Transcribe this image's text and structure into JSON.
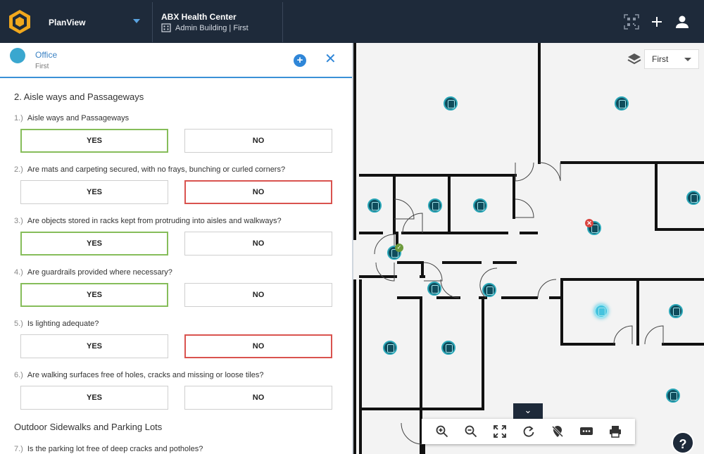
{
  "header": {
    "app_name": "PlanView",
    "site_title": "ABX Health Center",
    "site_sub": "Admin Building | First",
    "icons": [
      "qr-code-icon",
      "plus-icon",
      "user-icon"
    ]
  },
  "panel": {
    "location_title": "Office",
    "location_sub": "First",
    "section_title": "2. Aisle ways and Passageways",
    "questions": [
      {
        "num": "1.)",
        "text": "Aisle ways and Passageways",
        "yes": "YES",
        "no": "NO",
        "selected": "yes"
      },
      {
        "num": "2.)",
        "text": "Are mats and carpeting secured, with no frays, bunching or curled corners?",
        "yes": "YES",
        "no": "NO",
        "selected": "no"
      },
      {
        "num": "3.)",
        "text": "Are objects stored in racks kept from protruding into aisles and walkways?",
        "yes": "YES",
        "no": "NO",
        "selected": "yes"
      },
      {
        "num": "4.)",
        "text": "Are guardrails provided where necessary?",
        "yes": "YES",
        "no": "NO",
        "selected": "yes"
      },
      {
        "num": "5.)",
        "text": "Is lighting adequate?",
        "yes": "YES",
        "no": "NO",
        "selected": "no"
      },
      {
        "num": "6.)",
        "text": "Are walking surfaces free of holes, cracks and missing or loose tiles?",
        "yes": "YES",
        "no": "NO",
        "selected": "none"
      }
    ],
    "section2_title": "Outdoor Sidewalks and Parking Lots",
    "last_question": {
      "num": "7.)",
      "text": "Is the parking lot free of deep cracks and potholes?"
    }
  },
  "map": {
    "floor_value": "First",
    "help_label": "?",
    "colors": {
      "pin": "#0f4c5c",
      "pin_active": "#46c3de",
      "yes_border": "#86bd5a",
      "no_border": "#d9534f",
      "accent": "#2f86d8",
      "topbar": "#1e2a3a"
    }
  }
}
